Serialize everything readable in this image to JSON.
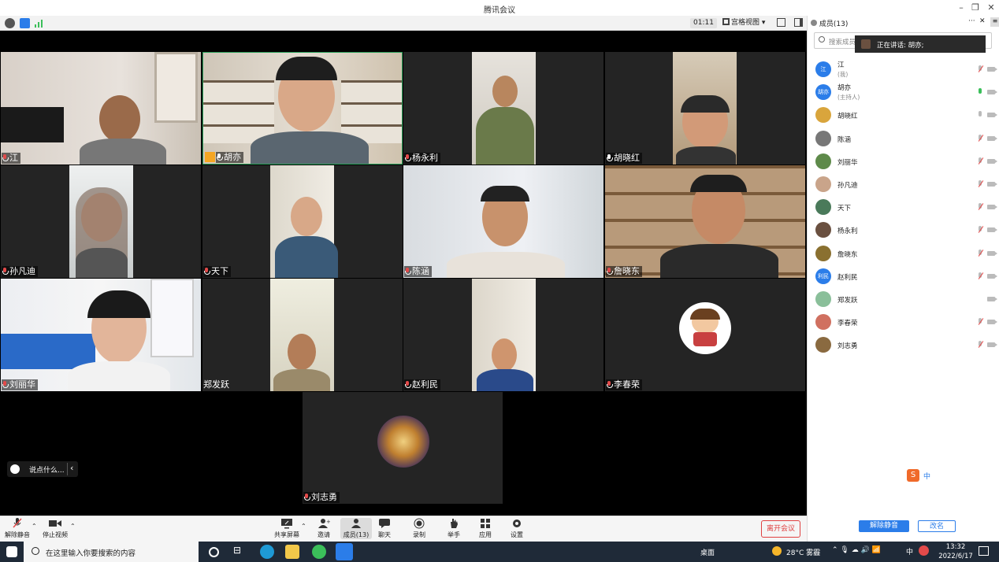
{
  "window": {
    "title": "腾讯会议"
  },
  "toolbar": {
    "timer": "01:11",
    "view_label": "宫格视图",
    "members_label": "成员(13)"
  },
  "tiles": [
    {
      "name": "江",
      "muted": true
    },
    {
      "name": "胡亦",
      "muted": false,
      "host": true
    },
    {
      "name": "杨永利",
      "muted": true
    },
    {
      "name": "胡晓红",
      "muted": false
    },
    {
      "name": "孙凡迪",
      "muted": true
    },
    {
      "name": "天下",
      "muted": true
    },
    {
      "name": "陈涵",
      "muted": true
    },
    {
      "name": "詹晓东",
      "muted": true
    },
    {
      "name": "刘丽华",
      "muted": true
    },
    {
      "name": "郑发跃",
      "muted": false
    },
    {
      "name": "赵利民",
      "muted": true
    },
    {
      "name": "李春荣",
      "muted": true
    },
    {
      "name": "刘志勇",
      "muted": true
    }
  ],
  "chat_pill": {
    "text": "说点什么..."
  },
  "bottombar": {
    "unmute": "解除静音",
    "stop_video": "停止视频",
    "share": "共享屏幕",
    "invite": "邀请",
    "members": "成员(13)",
    "chat": "聊天",
    "record": "录制",
    "raise_hand": "举手",
    "apps": "应用",
    "settings": "设置",
    "leave": "离开会议"
  },
  "panel": {
    "search_placeholder": "搜索成员",
    "speaking_label": "正在讲话: 胡亦;",
    "members": [
      {
        "name": "江",
        "sub": "(我)",
        "avatar_text": "江",
        "avatar_color": "#2b7de9",
        "mic": "red"
      },
      {
        "name": "胡亦",
        "sub": "(主持人)",
        "avatar_text": "胡亦",
        "avatar_color": "#2b7de9",
        "mic": "green"
      },
      {
        "name": "胡晓红",
        "avatar_color": "#d9a53c",
        "mic": "gray"
      },
      {
        "name": "陈涵",
        "avatar_color": "#777777",
        "mic": "red"
      },
      {
        "name": "刘丽华",
        "avatar_color": "#5e8a4a",
        "mic": "red"
      },
      {
        "name": "孙凡迪",
        "avatar_color": "#c9a48a",
        "mic": "red"
      },
      {
        "name": "天下",
        "avatar_color": "#4a7a5a",
        "mic": "red"
      },
      {
        "name": "杨永利",
        "avatar_color": "#6a5040",
        "mic": "red"
      },
      {
        "name": "詹晓东",
        "avatar_color": "#8a7030",
        "mic": "red"
      },
      {
        "name": "赵利民",
        "avatar_text": "利民",
        "avatar_color": "#2b7de9",
        "mic": "red"
      },
      {
        "name": "郑发跃",
        "avatar_color": "#8abf9a",
        "mic": "none"
      },
      {
        "name": "李春荣",
        "avatar_color": "#d07060",
        "mic": "red"
      },
      {
        "name": "刘志勇",
        "avatar_color": "#8a6a40",
        "mic": "red"
      }
    ],
    "unmute_all": "解除静音",
    "rename": "改名"
  },
  "taskbar": {
    "search_placeholder": "在这里输入你要搜索的内容",
    "desktop": "桌面",
    "weather": "28°C 雾霾",
    "ime": "中",
    "time": "13:32",
    "date": "2022/6/17"
  }
}
